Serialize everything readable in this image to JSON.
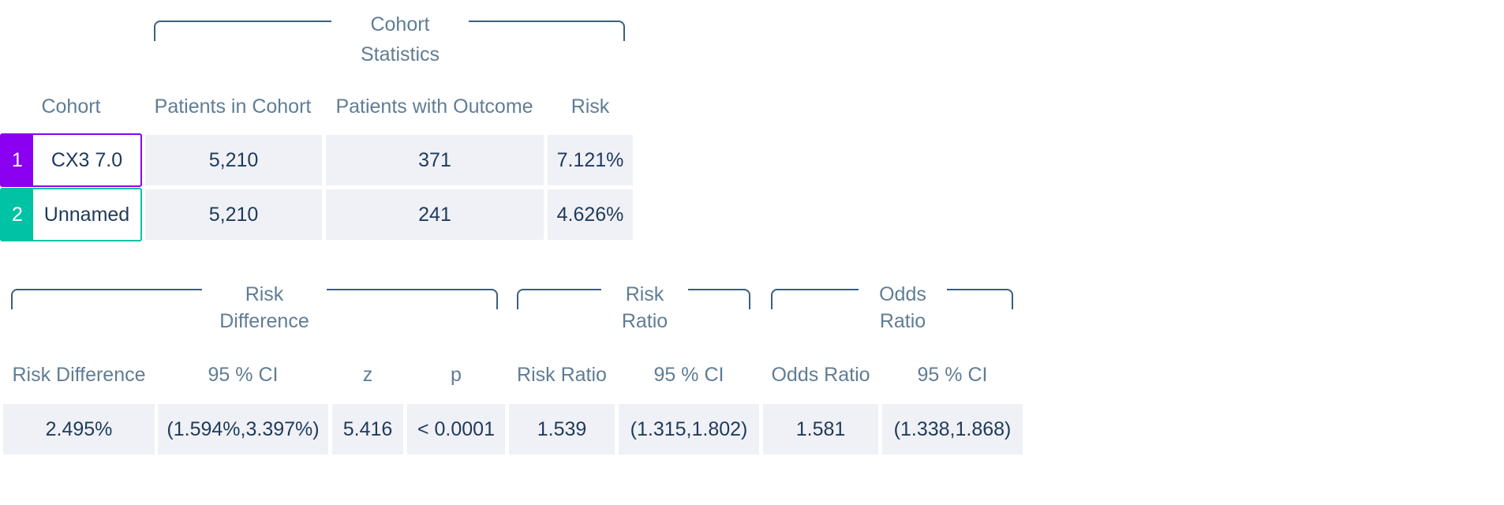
{
  "cohort_stats": {
    "group_title_line1": "Cohort",
    "group_title_line2": "Statistics",
    "columns": [
      "Cohort",
      "Patients in Cohort",
      "Patients with Outcome",
      "Risk"
    ],
    "rows": [
      {
        "index": "1",
        "name": "CX3 7.0",
        "patients": "5,210",
        "with_outcome": "371",
        "risk": "7.121%",
        "color": "#8a00f0"
      },
      {
        "index": "2",
        "name": "Unnamed",
        "patients": "5,210",
        "with_outcome": "241",
        "risk": "4.626%",
        "color": "#00c3a5"
      }
    ]
  },
  "comparison": {
    "groups": [
      {
        "line1": "Risk",
        "line2": "Difference"
      },
      {
        "line1": "Risk",
        "line2": "Ratio"
      },
      {
        "line1": "Odds",
        "line2": "Ratio"
      }
    ],
    "columns": [
      "Risk Difference",
      "95 % CI",
      "z",
      "p",
      "Risk Ratio",
      "95 % CI",
      "Odds Ratio",
      "95 % CI"
    ],
    "values": [
      "2.495%",
      "(1.594%,3.397%)",
      "5.416",
      "< 0.0001",
      "1.539",
      "(1.315,1.802)",
      "1.581",
      "(1.338,1.868)"
    ]
  },
  "colors": {
    "header_text": "#5f7d95",
    "value_text": "#1f3a5a",
    "cell_bg": "#eff1f6",
    "bracket": "#3a5f7d"
  }
}
